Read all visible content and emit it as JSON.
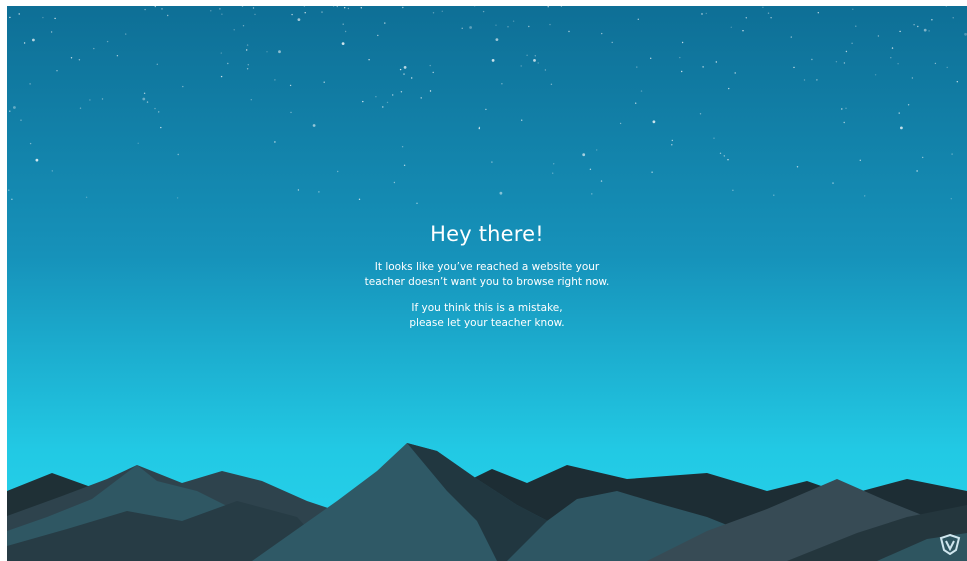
{
  "message": {
    "headline": "Hey there!",
    "para1": [
      "It looks like you’ve reached a website your",
      "teacher doesn’t want you to browse right now."
    ],
    "para2": [
      "If you think this is a mistake,",
      "please let your teacher know."
    ]
  },
  "colors": {
    "sky_top": "#0e6f96",
    "sky_mid": "#1897bd",
    "sky_bottom": "#24cfe8",
    "mountain_dark": "#1d2d34",
    "mountain_slate": "#344a54",
    "mountain_teal": "#2f5a66",
    "text": "#ffffff"
  },
  "icons": {
    "brand": "shield-logo-icon"
  }
}
